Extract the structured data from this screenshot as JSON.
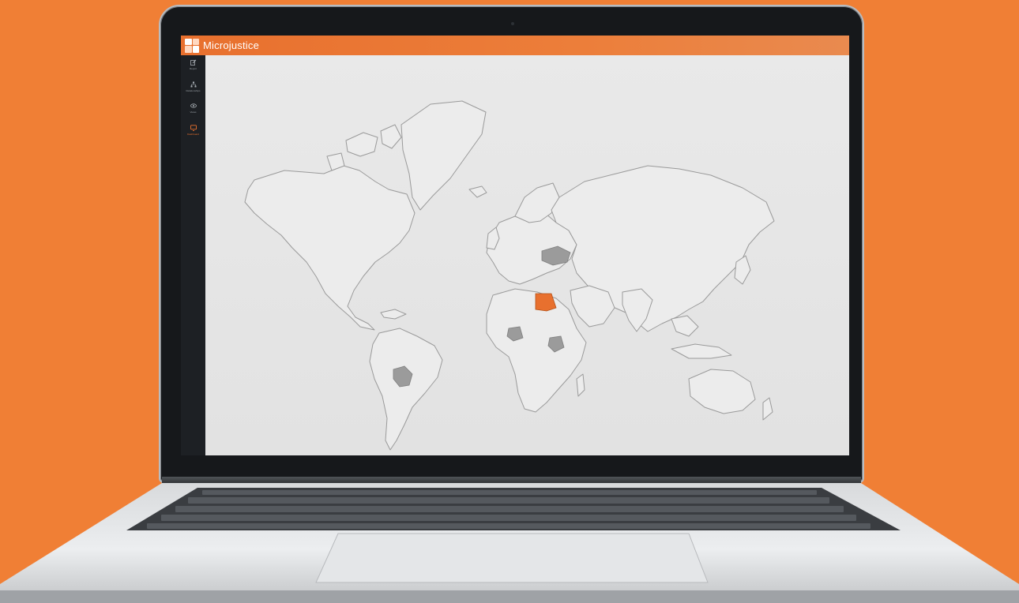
{
  "app": {
    "title": "Microjustice",
    "brand_color": "#e8702e"
  },
  "sidebar": {
    "items": [
      {
        "label": "Report",
        "icon": "edit-icon",
        "active": false
      },
      {
        "label": "Relationships",
        "icon": "hierarchy-icon",
        "active": false
      },
      {
        "label": "Views",
        "icon": "eye-icon",
        "active": false
      },
      {
        "label": "Dashboard",
        "icon": "monitor-icon",
        "active": true
      }
    ]
  },
  "map": {
    "highlighted_orange": [
      "Egypt"
    ],
    "highlighted_grey": [
      "Ukraine",
      "Bolivia",
      "Kenya",
      "Nigeria"
    ],
    "colors": {
      "orange": "#e8702e",
      "grey": "#9b9b9b",
      "land": "#ececec",
      "border": "#9a9a9a"
    }
  }
}
